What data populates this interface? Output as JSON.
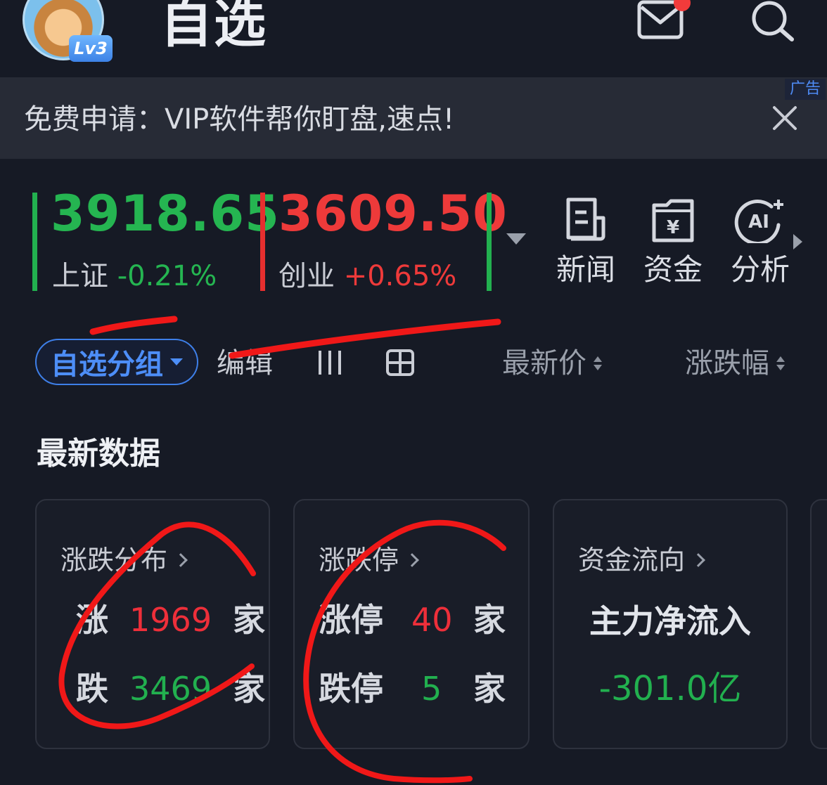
{
  "header": {
    "title": "自选",
    "level_badge": "Lv3",
    "avatar_icon": "bull-avatar-icon",
    "mail_icon": "mail-icon",
    "search_icon": "search-icon"
  },
  "ad": {
    "text": "免费申请：VIP软件帮你盯盘,速点!",
    "tag": "广告",
    "close_icon": "close-icon"
  },
  "indices": [
    {
      "value": "3918.65",
      "name": "上证",
      "change": "-0.21%",
      "color": "#25b551"
    },
    {
      "value": "3609.50",
      "name": "创业",
      "change": "+0.65%",
      "color": "#ee3a3a"
    }
  ],
  "tools": [
    {
      "label": "新闻",
      "icon": "news-icon"
    },
    {
      "label": "资金",
      "icon": "fund-icon"
    },
    {
      "label": "分析",
      "icon": "ai-analysis-icon"
    }
  ],
  "toolbar": {
    "group_label": "自选分组",
    "edit_label": "编辑",
    "sort_price": "最新价",
    "sort_change": "涨跌幅"
  },
  "section": {
    "title": "最新数据"
  },
  "cards": {
    "distribution": {
      "title": "涨跌分布",
      "up_label": "涨",
      "up_value": "1969",
      "down_label": "跌",
      "down_value": "3469",
      "unit": "家"
    },
    "limit": {
      "title": "涨跌停",
      "up_label": "涨停",
      "up_value": "40",
      "down_label": "跌停",
      "down_value": "5",
      "unit": "家"
    },
    "flow": {
      "title": "资金流向",
      "label": "主力净流入",
      "value": "-301.0亿"
    }
  },
  "colors": {
    "background": "#161a25",
    "up_red": "#ee2f3a",
    "down_green": "#22b04f",
    "accent_blue": "#4d8ef7"
  }
}
